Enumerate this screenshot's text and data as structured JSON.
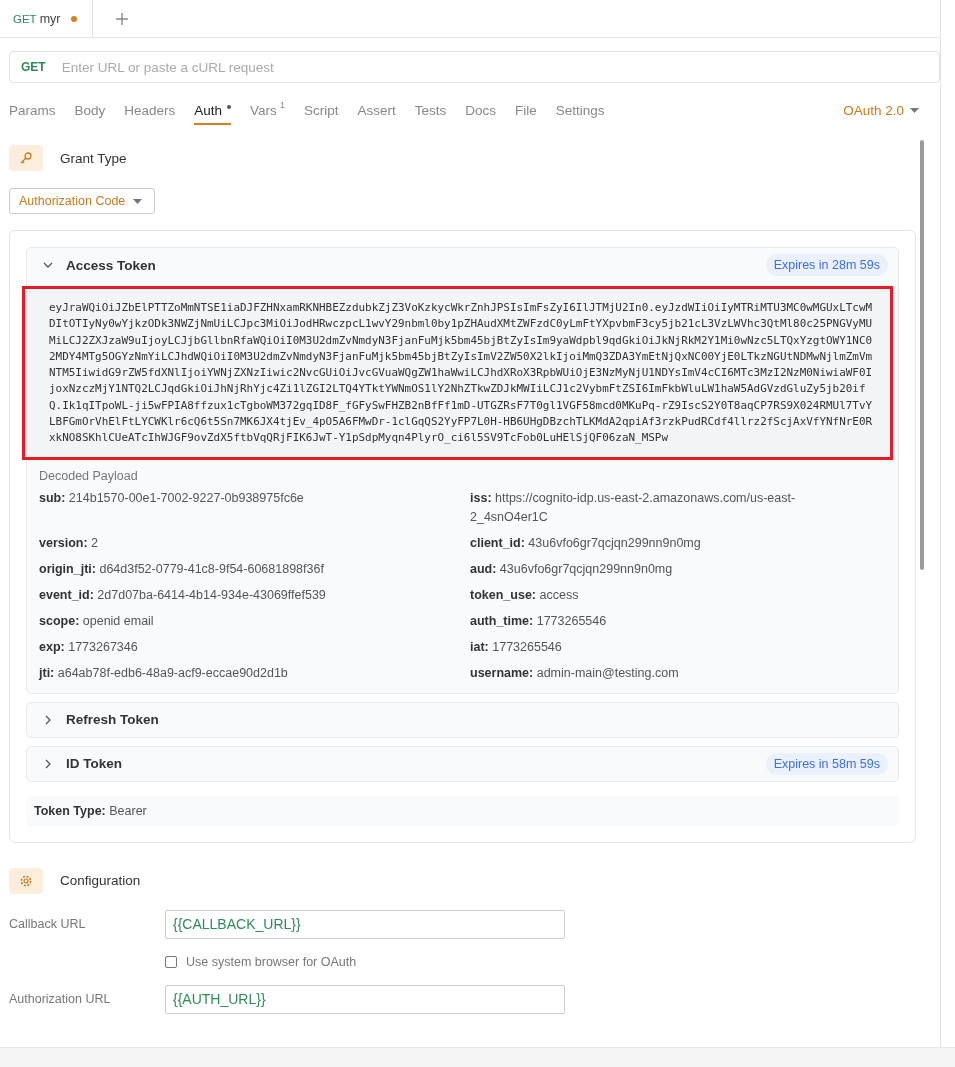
{
  "request_tab": {
    "method": "GET",
    "name": "myr",
    "unsaved": true
  },
  "url_bar": {
    "method": "GET",
    "placeholder": "Enter URL or paste a cURL request"
  },
  "tabs": [
    {
      "label": "Params",
      "selected": false,
      "modified": false
    },
    {
      "label": "Body",
      "selected": false,
      "modified": false
    },
    {
      "label": "Headers",
      "selected": false,
      "modified": false
    },
    {
      "label": "Auth",
      "selected": true,
      "modified": true
    },
    {
      "label": "Vars",
      "selected": false,
      "modified": false,
      "count": "1"
    },
    {
      "label": "Script",
      "selected": false,
      "modified": false
    },
    {
      "label": "Assert",
      "selected": false,
      "modified": false
    },
    {
      "label": "Tests",
      "selected": false,
      "modified": false
    },
    {
      "label": "Docs",
      "selected": false,
      "modified": false
    },
    {
      "label": "File",
      "selected": false,
      "modified": false
    },
    {
      "label": "Settings",
      "selected": false,
      "modified": false
    }
  ],
  "auth_mode": "OAuth 2.0",
  "grant_type": {
    "title": "Grant Type",
    "value": "Authorization Code"
  },
  "tokens": [
    {
      "title": "Access Token",
      "expanded": true,
      "expires": "Expires in 28m 59s",
      "highlighted": true,
      "value": "eyJraWQiOiJZbElPTTZoMmNTSE1iaDJFZHNxamRKNHBEZzdubkZjZ3VoKzkycWkrZnhJPSIsImFsZyI6IlJTMjU2In0.eyJzdWIiOiIyMTRiMTU3MC0wMGUxLTcwMDItOTIyNy0wYjkzODk3NWZjNmUiLCJpc3MiOiJodHRwczpcL1wvY29nbml0by1pZHAudXMtZWFzdC0yLmFtYXpvbmF3cy5jb21cL3VzLWVhc3QtMl80c25PNGVyMUMiLCJ2ZXJzaW9uIjoyLCJjbGllbnRfaWQiOiI0M3U2dmZvNmdyN3FjanFuMjk5bm45bjBtZyIsIm9yaWdpbl9qdGkiOiJkNjRkM2Y1Mi0wNzc5LTQxYzgtOWY1NC02MDY4MTg5OGYzNmYiLCJhdWQiOiI0M3U2dmZvNmdyN3FjanFuMjk5bm45bjBtZyIsImV2ZW50X2lkIjoiMmQ3ZDA3YmEtNjQxNC00YjE0LTkzNGUtNDMwNjlmZmVmNTM5IiwidG9rZW5fdXNlIjoiYWNjZXNzIiwic2NvcGUiOiJvcGVuaWQgZW1haWwiLCJhdXRoX3RpbWUiOjE3NzMyNjU1NDYsImV4cCI6MTc3MzI2NzM0NiwiaWF0IjoxNzczMjY1NTQ2LCJqdGkiOiJhNjRhYjc4Zi1lZGI2LTQ4YTktYWNmOS1lY2NhZTkwZDJkMWIiLCJ1c2VybmFtZSI6ImFkbWluLW1haW5AdGVzdGluZy5jb20ifQ.Ik1qITpoWL-ji5wFPIA8ffzux1cTgboWM372gqID8F_fGFySwFHZB2nBfFf1mD-UTGZRsF7T0gl1VGF58mcd0MKuPq-rZ9IscS2Y0T8aqCP7RS9X024RMUl7TvYLBFGmOrVhElFtLYCWKlr6cQ6t5Sn7MK6JX4tjEv_4pO5A6FMwDr-1clGqQS2YyFP7L0H-HB6UHgDBzchTLKMdA2qpiAf3rzkPudRCdf4llrz2fScjAxVfYNfNrE0RxkNO8SKhlCUeATcIhWJGF9ovZdX5ftbVqQRjFIK6JwT-Y1pSdpMyqn4PlyrO_ci6l5SV9TcFob0LuHElSjQF06zaN_MSPw",
      "payload_title": "Decoded Payload",
      "payload": [
        {
          "key": "sub:",
          "value": "214b1570-00e1-7002-9227-0b938975fc6e"
        },
        {
          "key": "iss:",
          "value": "https://cognito-idp.us-east-2.amazonaws.com/us-east-2_4snO4er1C"
        },
        {
          "key": "version:",
          "value": "2"
        },
        {
          "key": "client_id:",
          "value": "43u6vfo6gr7qcjqn299nn9n0mg"
        },
        {
          "key": "origin_jti:",
          "value": "d64d3f52-0779-41c8-9f54-60681898f36f"
        },
        {
          "key": "aud:",
          "value": "43u6vfo6gr7qcjqn299nn9n0mg"
        },
        {
          "key": "event_id:",
          "value": "2d7d07ba-6414-4b14-934e-43069ffef539"
        },
        {
          "key": "token_use:",
          "value": "access"
        },
        {
          "key": "scope:",
          "value": "openid email"
        },
        {
          "key": "auth_time:",
          "value": "1773265546"
        },
        {
          "key": "exp:",
          "value": "1773267346"
        },
        {
          "key": "iat:",
          "value": "1773265546"
        },
        {
          "key": "jti:",
          "value": "a64ab78f-edb6-48a9-acf9-eccae90d2d1b"
        },
        {
          "key": "username:",
          "value": "admin-main@testing.com"
        }
      ]
    },
    {
      "title": "Refresh Token",
      "expanded": false
    },
    {
      "title": "ID Token",
      "expanded": false,
      "expires": "Expires in 58m 59s"
    }
  ],
  "token_type": {
    "key": "Token Type:",
    "value": "Bearer"
  },
  "configuration": {
    "title": "Configuration",
    "fields": [
      {
        "kind": "input",
        "label": "Callback URL",
        "value": "{{CALLBACK_URL}}"
      },
      {
        "kind": "checkbox",
        "label": "Use system browser for OAuth",
        "checked": false
      },
      {
        "kind": "input",
        "label": "Authorization URL",
        "value": "{{AUTH_URL}}"
      }
    ]
  }
}
